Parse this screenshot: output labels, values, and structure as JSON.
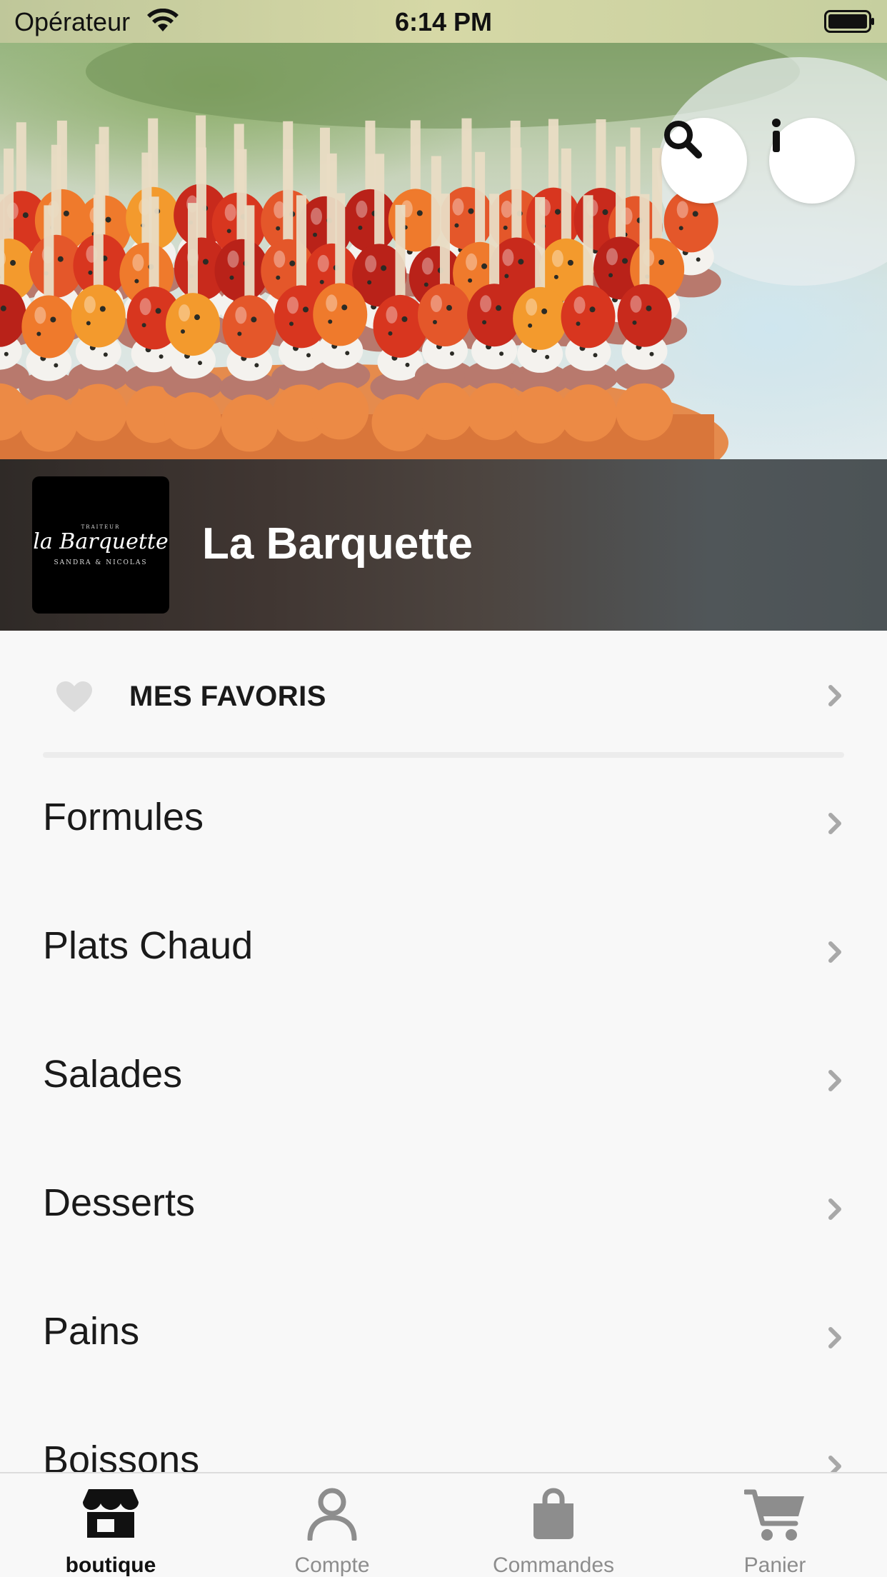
{
  "status_bar": {
    "carrier": "Opérateur",
    "time": "6:14 PM"
  },
  "hero": {
    "search_icon": "search-icon",
    "info_icon": "info-icon"
  },
  "store": {
    "name": "La Barquette",
    "logo": {
      "small": "TRAITEUR",
      "script": "la Barquette",
      "sub": "SANDRA & NICOLAS"
    }
  },
  "favorites": {
    "label": "MES FAVORIS",
    "icon": "heart-icon"
  },
  "categories": [
    {
      "label": "Formules"
    },
    {
      "label": "Plats Chaud"
    },
    {
      "label": "Salades"
    },
    {
      "label": "Desserts"
    },
    {
      "label": "Pains"
    },
    {
      "label": "Boissons"
    }
  ],
  "tabs": [
    {
      "label": "boutique",
      "icon": "store-icon",
      "active": true
    },
    {
      "label": "Compte",
      "icon": "user-icon",
      "active": false
    },
    {
      "label": "Commandes",
      "icon": "bag-icon",
      "active": false
    },
    {
      "label": "Panier",
      "icon": "cart-icon",
      "active": false
    }
  ],
  "colors": {
    "active_tab": "#111111",
    "inactive_tab": "#8d8d8d",
    "banner": "#403632"
  }
}
